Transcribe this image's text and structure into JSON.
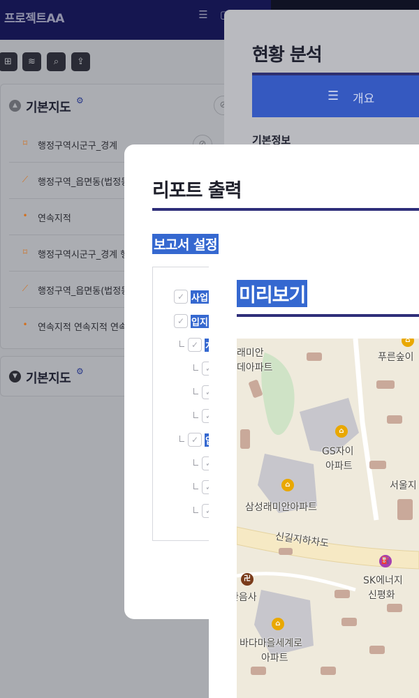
{
  "app": {
    "title": "프로젝트AA",
    "header_icons": [
      "list-icon",
      "window-icon"
    ]
  },
  "toolbar": {
    "buttons": [
      "add-folder-icon",
      "add-layer-icon",
      "search-icon",
      "upload-icon"
    ]
  },
  "layer_groups": [
    {
      "title": "기본지도",
      "expanded": true,
      "layers": [
        {
          "label": "행정구역시군구_경계",
          "icon": "polygon-icon"
        },
        {
          "label": "행정구역_읍면동(법정동",
          "icon": "line-icon"
        },
        {
          "label": "연속지적",
          "icon": "point-icon"
        },
        {
          "label": "행정구역시군구_경계 행",
          "icon": "polygon-icon"
        },
        {
          "label": "행정구역_읍면동(법정동",
          "icon": "line-icon"
        },
        {
          "label": "연속지적 연속지적 연속",
          "icon": "point-icon"
        }
      ]
    },
    {
      "title": "기본지도",
      "expanded": false,
      "layers": []
    }
  ],
  "analysis_panel": {
    "title": "현황 분석",
    "tab_label": "개요",
    "section_label": "기본정보"
  },
  "report_modal": {
    "title": "리포트 출력",
    "settings_title": "보고서 설정",
    "items": [
      {
        "label": "사업",
        "level": 0
      },
      {
        "label": "입지",
        "level": 0
      },
      {
        "label": "개",
        "level": 1
      },
      {
        "label": "",
        "level": 2
      },
      {
        "label": "",
        "level": 2
      },
      {
        "label": "",
        "level": 2
      },
      {
        "label": "입",
        "level": 1
      },
      {
        "label": "",
        "level": 2
      },
      {
        "label": "",
        "level": 2
      },
      {
        "label": "",
        "level": 2
      }
    ]
  },
  "preview_modal": {
    "title": "미리보기",
    "map_labels": {
      "apt1": "래미안",
      "apt1b": "데아파트",
      "green": "푸른숲이",
      "gs1": "GS자이",
      "gs2": "아파트",
      "seoul": "서울지",
      "samsung": "삼성래미안아파트",
      "road": "신길지하차도",
      "sk1": "SK에너지",
      "sk2": "신평화",
      "temple": "관음사",
      "bada1": "바다마을세계로",
      "bada2": "아파트"
    }
  },
  "colors": {
    "header_bg": "#151650",
    "accent_blue": "#3568d0",
    "rule_navy": "#2f2f7a",
    "layer_icon": "#d2701e"
  }
}
